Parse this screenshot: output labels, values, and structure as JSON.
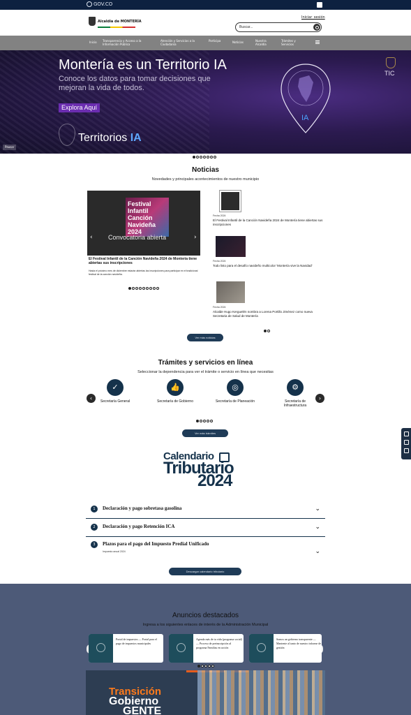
{
  "gov": {
    "logo": "GOV.CO",
    "accessibility_icon": "accessibility-icon"
  },
  "header": {
    "brand": "Alcaldía de MONTERÍA",
    "top_link": "Iniciar_sesión",
    "search_value": "Buscar..."
  },
  "nav": {
    "items": [
      "Inicio",
      "Transparencia y Acceso a la Información Pública",
      "Atención y Servicios a la Ciudadanía",
      "Participa",
      "Noticias",
      "Nuestra Alcaldía",
      "Trámites y Servicios"
    ]
  },
  "hero": {
    "title": "Montería es un Territorio IA",
    "subtitle": "Conoce los datos para tomar decisiones que mejoran la vida de todos.",
    "cta": "Explora Aquí",
    "tagline_a": "Territorios ",
    "tagline_b": "IA",
    "pin_label": "IA",
    "tic": "TIC",
    "pause": "Pausar"
  },
  "news": {
    "title": "Noticias",
    "subtitle": "Novedades y principales acontecimientos de nuestro municipio",
    "featured": {
      "poster_text": "Festival Infantil Canción Navideña 2024",
      "caption": "Convocatoria abierta",
      "title": "El Festival Infantil de la Canción Navideña 2024 de Montería tiene abiertas sus inscripciones",
      "desc": "Hasta el próximo mes de diciembre estarán abiertas las inscripciones para participar en el tradicional festival de la canción navideña."
    },
    "side": [
      {
        "date": "Fecha 2024",
        "title": "El Festival Infantil de la Canción Navideña 2024 de Montería tiene abiertas sus inscripciones"
      },
      {
        "date": "Fecha 2024",
        "title": "Todo listo para el desafío navideño multicolor 'Montería vive la Navidad'"
      },
      {
        "date": "Fecha 2024",
        "title": "Alcalde Hugo Kerguelén nombra a Lorena Portillo Jiménez como nueva Secretaria de Salud de Montería"
      }
    ],
    "more_button": "Ver más noticias"
  },
  "tramites": {
    "title": "Trámites y servicios en línea",
    "subtitle": "Seleccionar la dependencia para ver el trámite o servicio en línea que necesitas",
    "items": [
      {
        "label": "Secretaría General",
        "icon": "check-icon"
      },
      {
        "label": "Secretaría de Gobierno",
        "icon": "thumbs-up-icon"
      },
      {
        "label": "Secretaría de Planeación",
        "icon": "target-icon"
      },
      {
        "label": "Secretaría de Infraestructura",
        "icon": "gear-icon"
      }
    ],
    "more_button": "Ver más trámites"
  },
  "calendar": {
    "line1": "Calendario",
    "line2": "Tributario",
    "line3": "2024",
    "items": [
      {
        "num": "1",
        "title": "Declaración y pago sobretasa gasolina"
      },
      {
        "num": "2",
        "title": "Declaración y pago Retención ICA"
      },
      {
        "num": "3",
        "title": "Plazos para el pago del Impuesto Predial Unificado",
        "note": "Impuesto anual 2024"
      }
    ],
    "more_button": "Descargar calendario tributario"
  },
  "anuncios": {
    "title": "Anuncios destacados",
    "subtitle": "Ingresa a los siguientes enlaces de interés de la Administración Municipal",
    "cards": [
      "Portal de impuestos — Portal para el pago de impuestos municipales",
      "Agenda más de tu vida (programa social) — Proceso de preinscripción al programa Familias en acción",
      "Somos un gobierno transparente — Mantente al tanto de nuestro informe de gestión"
    ],
    "banner_w1": "Transición",
    "banner_w2": "Gobierno",
    "banner_w3": "GENTE"
  }
}
